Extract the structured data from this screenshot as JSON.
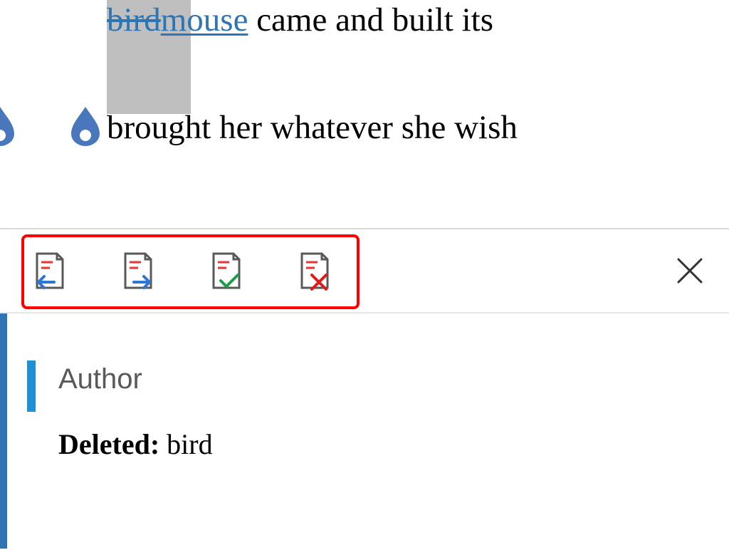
{
  "document": {
    "deleted_word": "bird",
    "inserted_word": "mouse",
    "line1_remainder": " came and built its",
    "line2": "brought her whatever she wish"
  },
  "toolbar": {
    "buttons": [
      {
        "name": "previous-change-button"
      },
      {
        "name": "next-change-button"
      },
      {
        "name": "accept-change-button"
      },
      {
        "name": "reject-change-button"
      }
    ]
  },
  "detail": {
    "author": "Author",
    "change_label": "Deleted:",
    "change_value": " bird"
  },
  "colors": {
    "track_change": "#2e75b6",
    "selection_bg": "#bfbfbf",
    "highlight_border": "#ff0000",
    "accent_bar": "#1f8fd6"
  }
}
